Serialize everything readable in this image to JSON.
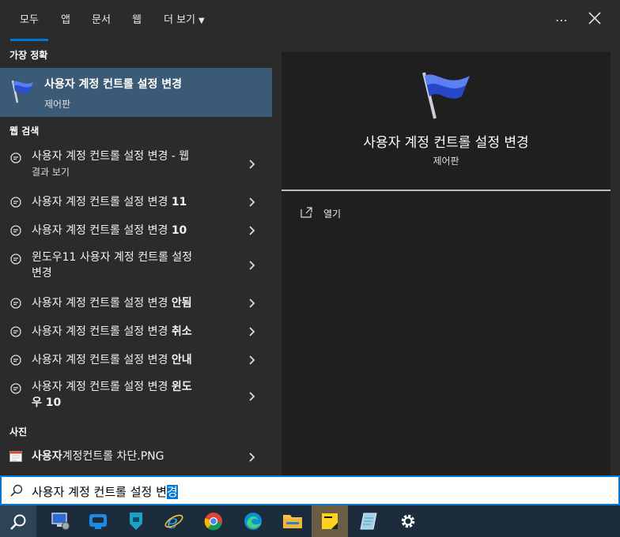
{
  "tabs": [
    {
      "label": "모두"
    },
    {
      "label": "앱"
    },
    {
      "label": "문서"
    },
    {
      "label": "웹"
    },
    {
      "label": "더 보기"
    }
  ],
  "best_match": {
    "section": "가장 정확",
    "title": "사용자 계정 컨트롤 설정 변경",
    "subtitle": "제어판"
  },
  "web": {
    "section": "웹 검색",
    "items": [
      {
        "line1": "사용자 계정 컨트롤 설정 변경 - 웹",
        "line2": "결과 보기"
      },
      {
        "plain": "사용자 계정 컨트롤 설정 변경 ",
        "bold": "11"
      },
      {
        "plain": "사용자 계정 컨트롤 설정 변경 ",
        "bold": "10"
      },
      {
        "line1": "윈도우11 사용자 계정 컨트롤 설정",
        "line2": "변경"
      },
      {
        "plain": "사용자 계정 컨트롤 설정 변경 ",
        "bold": "안됨"
      },
      {
        "plain": "사용자 계정 컨트롤 설정 변경 ",
        "bold": "취소"
      },
      {
        "plain": "사용자 계정 컨트롤 설정 변경 ",
        "bold": "안내"
      },
      {
        "line1_plain": "사용자 계정 컨트롤 설정 변경 ",
        "line1_bold": "윈도",
        "line2": "우 10"
      }
    ]
  },
  "photos": {
    "section": "사진",
    "item": {
      "bold": "사용자",
      "plain": "계정컨트롤 차단.PNG"
    }
  },
  "detail": {
    "title": "사용자 계정 컨트롤 설정 변경",
    "subtitle": "제어판",
    "open_label": "열기"
  },
  "search": {
    "text_before": "사용자 계정 컨트롤 설정 변",
    "text_selected": "경"
  },
  "colors": {
    "accent": "#0078d7",
    "selected_row": "#3a5a75"
  },
  "taskbar": [
    "search-icon",
    "remote-desktop-icon",
    "app-icon",
    "shield-app-icon",
    "internet-explorer-icon",
    "chrome-icon",
    "edge-icon",
    "file-explorer-icon",
    "sticky-notes-icon",
    "notepad-icon",
    "settings-icon"
  ]
}
